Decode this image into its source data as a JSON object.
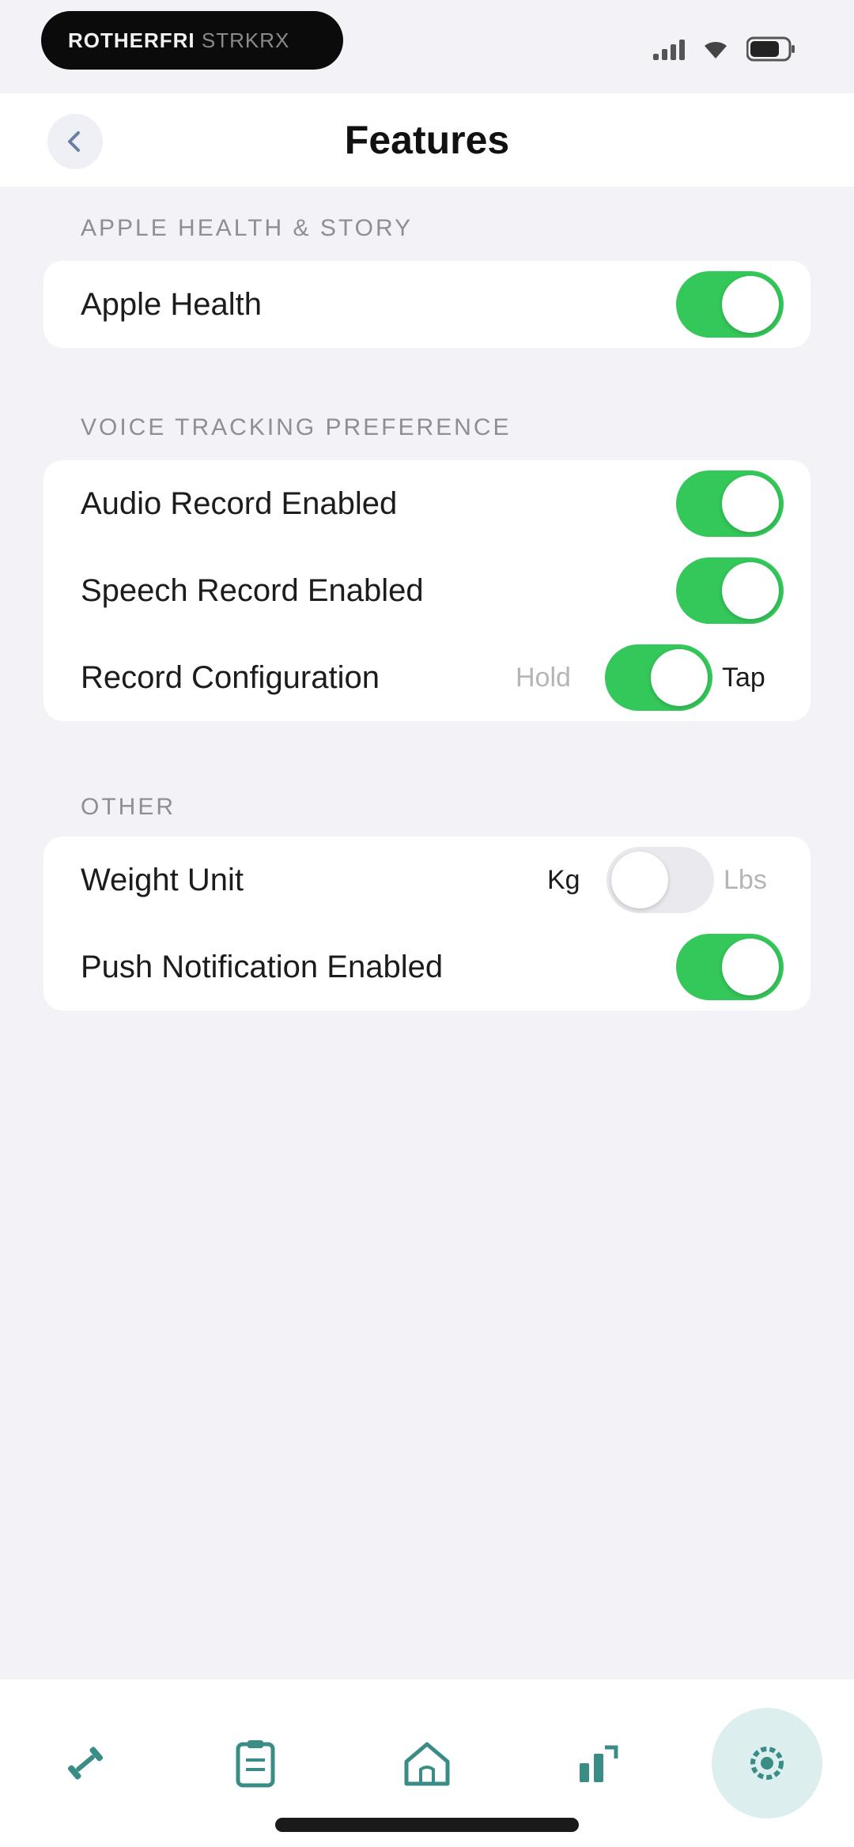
{
  "status_bar": {
    "pill_text_main": "ROTHERFRI",
    "pill_text_dim": "STRKRX"
  },
  "nav": {
    "title": "Features"
  },
  "sections": [
    {
      "header": "APPLE HEALTH & STORY",
      "rows": [
        {
          "label": "Apple Health",
          "state": "on"
        }
      ]
    },
    {
      "header": "VOICE TRACKING PREFERENCE",
      "rows": [
        {
          "label": "Audio Record Enabled",
          "state": "on"
        },
        {
          "label": "Speech Record Enabled",
          "state": "on"
        },
        {
          "label": "Record Configuration",
          "state": "on",
          "option_left": "Hold",
          "option_right": "Tap"
        }
      ]
    },
    {
      "header": "OTHER",
      "rows": [
        {
          "label": "Weight Unit",
          "state": "off",
          "option_left": "Kg",
          "option_right": "Lbs"
        },
        {
          "label": "Push Notification Enabled",
          "state": "on"
        }
      ]
    }
  ],
  "tabs": [
    {
      "name": "workout",
      "icon": "dumbbell-icon",
      "active": false
    },
    {
      "name": "log",
      "icon": "clipboard-icon",
      "active": false
    },
    {
      "name": "home",
      "icon": "home-icon",
      "active": false
    },
    {
      "name": "stats",
      "icon": "chart-icon",
      "active": false
    },
    {
      "name": "settings",
      "icon": "gear-icon",
      "active": true
    }
  ],
  "colors": {
    "background": "#f2f2f7",
    "toggle_on": "#34c759",
    "toggle_off": "#e9e9ee",
    "tab_icon": "#3a8c86",
    "tab_active_bg": "#dcefee"
  }
}
